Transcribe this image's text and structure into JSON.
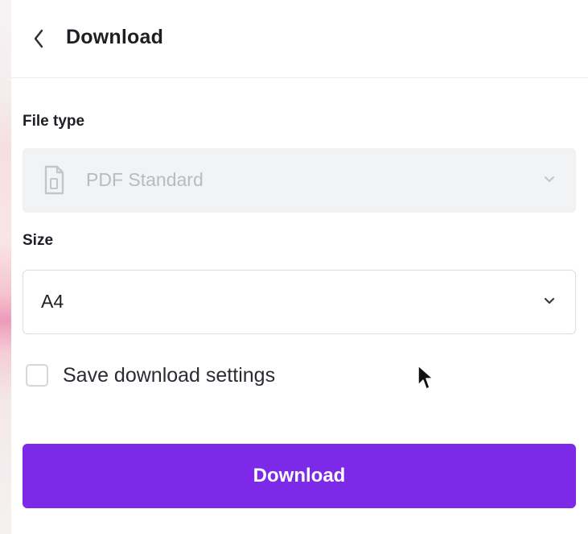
{
  "header": {
    "back_icon": "chevron-left-icon",
    "title": "Download"
  },
  "file_type": {
    "label": "File type",
    "value": "PDF Standard",
    "icon": "file-icon",
    "dropdown_icon": "chevron-down-icon",
    "disabled": true
  },
  "size": {
    "label": "Size",
    "value": "A4",
    "dropdown_icon": "chevron-down-icon"
  },
  "save_settings": {
    "label": "Save download settings",
    "checked": false
  },
  "actions": {
    "download_label": "Download"
  },
  "colors": {
    "accent": "#7d2ae8",
    "text": "#1e1e24",
    "disabled_bg": "#f2f3f5",
    "disabled_text": "#b9bbc2"
  }
}
